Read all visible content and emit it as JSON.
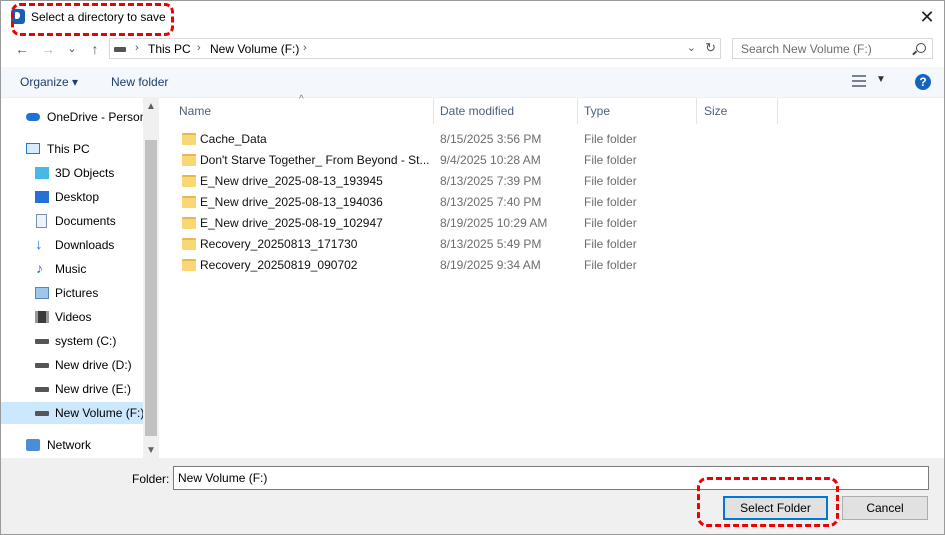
{
  "window": {
    "title": "Select a directory to save",
    "close_glyph": "✕"
  },
  "address_bar": {
    "back_glyph": "←",
    "forward_glyph": "→",
    "dropdown_glyph": "⌄",
    "up_glyph": "↑",
    "breadcrumbs": [
      "This PC",
      "New Volume (F:)"
    ],
    "separator": "›",
    "refresh_glyph": "↻"
  },
  "search": {
    "placeholder": "Search New Volume (F:)"
  },
  "toolbar": {
    "organize": "Organize ▾",
    "new_folder": "New folder",
    "help": "?"
  },
  "nav": {
    "items": [
      {
        "label": "OneDrive - Person",
        "icon": "onedrive-icon"
      },
      {
        "label": "This PC",
        "icon": "this-pc-icon"
      },
      {
        "label": "3D Objects",
        "icon": "3d-objects-icon"
      },
      {
        "label": "Desktop",
        "icon": "desktop-icon"
      },
      {
        "label": "Documents",
        "icon": "documents-icon"
      },
      {
        "label": "Downloads",
        "icon": "downloads-icon"
      },
      {
        "label": "Music",
        "icon": "music-icon"
      },
      {
        "label": "Pictures",
        "icon": "pictures-icon"
      },
      {
        "label": "Videos",
        "icon": "videos-icon"
      },
      {
        "label": "system (C:)",
        "icon": "system-drive-icon"
      },
      {
        "label": "New drive (D:)",
        "icon": "drive-icon"
      },
      {
        "label": "New drive (E:)",
        "icon": "drive-icon"
      },
      {
        "label": "New Volume (F:)",
        "icon": "drive-icon",
        "selected": true
      },
      {
        "label": "Network",
        "icon": "network-icon"
      }
    ],
    "scroll_up": "▲",
    "scroll_down": "▼"
  },
  "columns": {
    "name": "Name",
    "date": "Date modified",
    "type": "Type",
    "size": "Size"
  },
  "files": [
    {
      "name": "Cache_Data",
      "date": "8/15/2025 3:56 PM",
      "type": "File folder"
    },
    {
      "name": "Don't Starve Together_ From Beyond - St...",
      "date": "9/4/2025 10:28 AM",
      "type": "File folder"
    },
    {
      "name": "E_New drive_2025-08-13_193945",
      "date": "8/13/2025 7:39 PM",
      "type": "File folder"
    },
    {
      "name": "E_New drive_2025-08-13_194036",
      "date": "8/13/2025 7:40 PM",
      "type": "File folder"
    },
    {
      "name": "E_New drive_2025-08-19_102947",
      "date": "8/19/2025 10:29 AM",
      "type": "File folder"
    },
    {
      "name": "Recovery_20250813_171730",
      "date": "8/13/2025 5:49 PM",
      "type": "File folder"
    },
    {
      "name": "Recovery_20250819_090702",
      "date": "8/19/2025 9:34 AM",
      "type": "File folder"
    }
  ],
  "footer": {
    "folder_label": "Folder:",
    "folder_value": "New Volume (F:)",
    "select_button": "Select Folder",
    "cancel_button": "Cancel"
  },
  "colors": {
    "highlight": "#ee0000",
    "selection": "#cce8ff",
    "accent": "#0078d7"
  }
}
